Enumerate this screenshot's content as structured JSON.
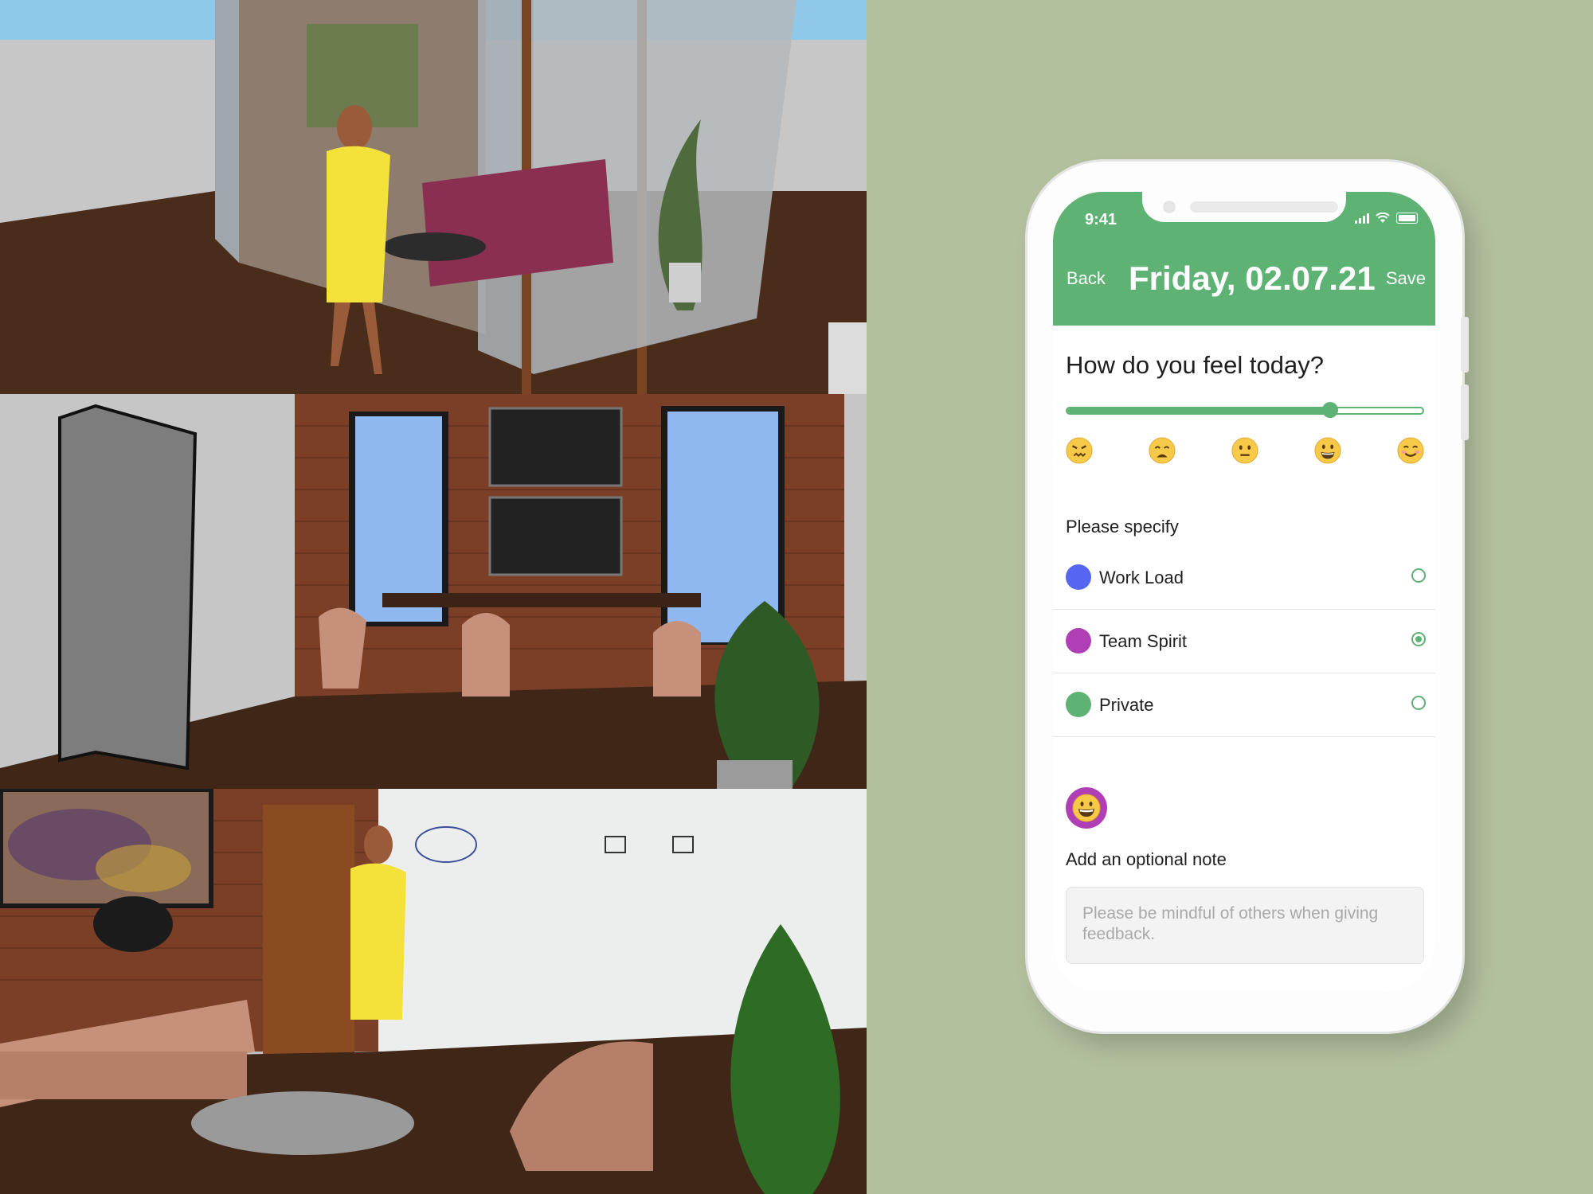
{
  "status_bar": {
    "time": "9:41"
  },
  "header": {
    "back_label": "Back",
    "title": "Friday, 02.07.21",
    "save_label": "Save",
    "color": "#5eb374"
  },
  "mood": {
    "question": "How do you feel today?",
    "slider_value": 0.74,
    "options": [
      {
        "icon": "angry-face-icon",
        "glyph": "😖"
      },
      {
        "icon": "weary-face-icon",
        "glyph": "😩"
      },
      {
        "icon": "neutral-face-icon",
        "glyph": "😐"
      },
      {
        "icon": "grinning-face-icon",
        "glyph": "😀"
      },
      {
        "icon": "smiling-face-icon",
        "glyph": "☺️"
      }
    ]
  },
  "specify": {
    "label": "Please specify",
    "items": [
      {
        "label": "Work Load",
        "color": "#5766f2",
        "selected": false
      },
      {
        "label": "Team Spirit",
        "color": "#b03fb6",
        "selected": true
      },
      {
        "label": "Private",
        "color": "#5eb374",
        "selected": false
      }
    ]
  },
  "note": {
    "label": "Add an optional note",
    "placeholder": "Please be mindful of others when giving feedback.",
    "selected_mood_icon": "grinning-face-icon"
  },
  "background_color": "#b3c09e"
}
